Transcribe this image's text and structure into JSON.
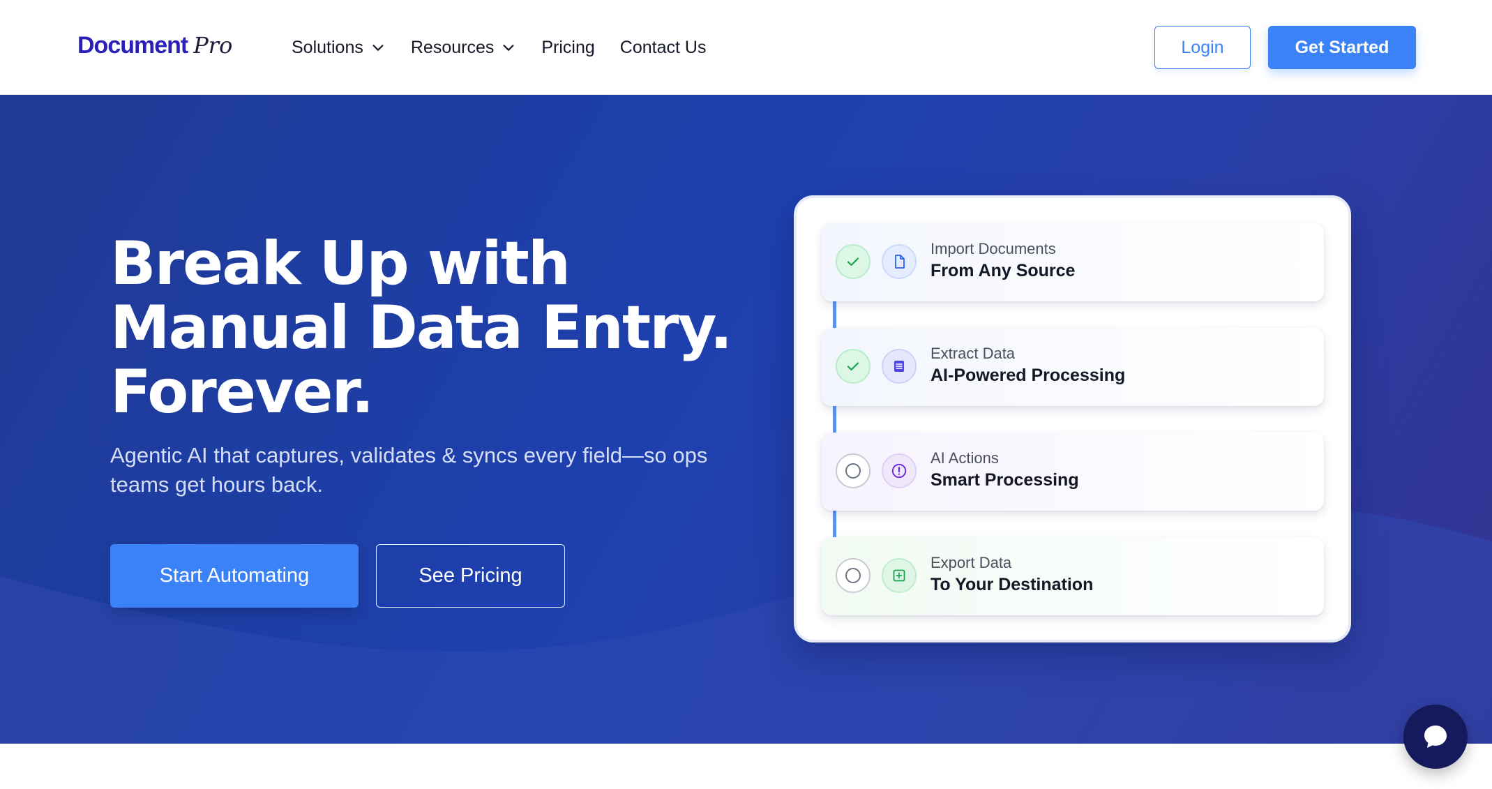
{
  "logo": {
    "main": "Document",
    "script": "Pro"
  },
  "nav": {
    "items": [
      {
        "label": "Solutions",
        "dropdown": true
      },
      {
        "label": "Resources",
        "dropdown": true
      },
      {
        "label": "Pricing",
        "dropdown": false
      },
      {
        "label": "Contact Us",
        "dropdown": false
      }
    ],
    "login_label": "Login",
    "get_started_label": "Get Started"
  },
  "hero": {
    "headline": [
      "Break Up with",
      "Manual Data Entry.",
      "Forever."
    ],
    "subtitle": "Agentic AI that captures, validates & syncs every field—so ops teams get hours back.",
    "cta_primary": "Start Automating",
    "cta_secondary": "See Pricing"
  },
  "workflow": {
    "steps": [
      {
        "label": "Import Documents",
        "title": "From Any Source",
        "status": "done",
        "icon": "document-icon"
      },
      {
        "label": "Extract Data",
        "title": "AI-Powered Processing",
        "status": "done",
        "icon": "list-icon"
      },
      {
        "label": "AI Actions",
        "title": "Smart Processing",
        "status": "pending",
        "icon": "alert-circle-icon"
      },
      {
        "label": "Export Data",
        "title": "To Your Destination",
        "status": "pending",
        "icon": "plus-square-icon"
      }
    ]
  },
  "colors": {
    "brand": "#2a1fb8",
    "accent": "#3b82f6",
    "hero_bg": "#1e40af",
    "done_green": "#16a34a"
  },
  "chat": {
    "icon": "chat-bubble-icon"
  }
}
